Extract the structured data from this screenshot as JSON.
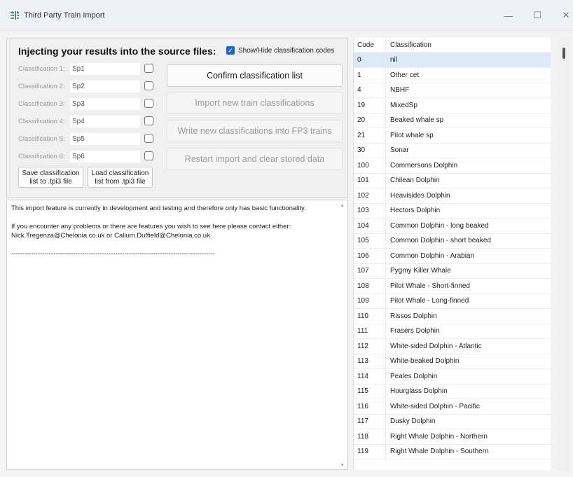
{
  "window": {
    "title": "Third Party Train Import",
    "minimize": "—",
    "maximize": "☐",
    "close": "✕"
  },
  "panel": {
    "heading": "Injecting your results into the source files:",
    "show_hide_label": "Show/Hide classification codes",
    "classifications": [
      {
        "label": "Classification 1:",
        "value": "Sp1"
      },
      {
        "label": "Classification 2:",
        "value": "Sp2"
      },
      {
        "label": "Classification 3:",
        "value": "Sp3"
      },
      {
        "label": "Classification 4:",
        "value": "Sp4"
      },
      {
        "label": "Classification 5:",
        "value": "Sp5"
      },
      {
        "label": "Classification 6:",
        "value": "Sp6"
      }
    ],
    "save_button": "Save classification list to .tpi3 file",
    "load_button": "Load classification list from .tpi3 file",
    "confirm_button": "Confirm classification list",
    "import_button": "Import new train classifications",
    "write_button": "Write new classifications into FP3 trains",
    "restart_button": "Restart import and clear stored data"
  },
  "log": {
    "line1": "This import feature is currently in development and testing and therefore only has basic functionality.",
    "line2": "If you encounter any problems or there are features you wish to see here please contact either: Nick.Tregenza@Chelonia.co.uk or Callum.Duffield@Chelonia.co.uk",
    "line3": "--------------------------------------------------------------------------------------------"
  },
  "table": {
    "headers": {
      "code": "Code",
      "classification": "Classification"
    },
    "rows": [
      {
        "code": "0",
        "classification": "nil"
      },
      {
        "code": "1",
        "classification": "Other cet"
      },
      {
        "code": "4",
        "classification": "NBHF"
      },
      {
        "code": "19",
        "classification": "MixedSp"
      },
      {
        "code": "20",
        "classification": "Beaked whale sp"
      },
      {
        "code": "21",
        "classification": "Pilot whale sp"
      },
      {
        "code": "30",
        "classification": "Sonar"
      },
      {
        "code": "100",
        "classification": "Commersons Dolphin"
      },
      {
        "code": "101",
        "classification": "Chilean Dolphin"
      },
      {
        "code": "102",
        "classification": "Heavisides Dolphin"
      },
      {
        "code": "103",
        "classification": "Hectors Dolphin"
      },
      {
        "code": "104",
        "classification": "Common Dolphin - long beaked"
      },
      {
        "code": "105",
        "classification": "Common Dolphin - short beaked"
      },
      {
        "code": "106",
        "classification": "Common Dolphin - Arabian"
      },
      {
        "code": "107",
        "classification": "Pygmy Killer Whale"
      },
      {
        "code": "108",
        "classification": "Pilot Whale - Short-finned"
      },
      {
        "code": "109",
        "classification": "Pilot Whale - Long-finned"
      },
      {
        "code": "110",
        "classification": "Rissos Dolphin"
      },
      {
        "code": "111",
        "classification": "Frasers Dolphin"
      },
      {
        "code": "112",
        "classification": "White-sided Dolphin - Atlantic"
      },
      {
        "code": "113",
        "classification": "White-beaked Dolphin"
      },
      {
        "code": "114",
        "classification": "Peales Dolphin"
      },
      {
        "code": "115",
        "classification": "Hourglass Dolphin"
      },
      {
        "code": "116",
        "classification": "White-sided Dolphin - Pacific"
      },
      {
        "code": "117",
        "classification": "Dusky Dolphin"
      },
      {
        "code": "118",
        "classification": "Right Whale Dolphin - Northern"
      },
      {
        "code": "119",
        "classification": "Right Whale Dolphin - Southern"
      }
    ]
  },
  "colors": {
    "accent": "#2166c9",
    "selected_row": "#dbe9f8"
  }
}
